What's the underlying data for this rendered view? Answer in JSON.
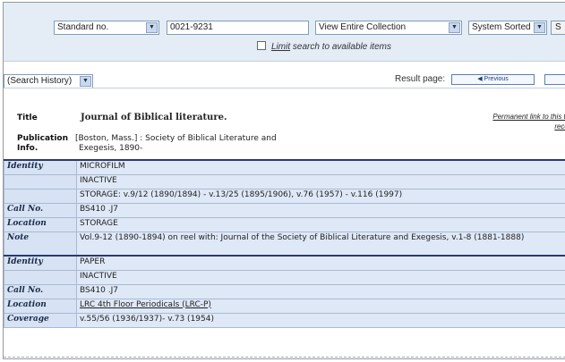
{
  "search": {
    "field_select": "Standard no.",
    "query_value": "0021-9231",
    "collection_select": "View Entire Collection",
    "sort_select": "System Sorted",
    "search_button": "S",
    "limit_prefix": "Limit",
    "limit_rest": " search to available items"
  },
  "history": {
    "select": "(Search History)"
  },
  "pagination": {
    "label": "Result page:",
    "previous": "Previous"
  },
  "bib": {
    "title_label": "Title",
    "title_value": "Journal of Biblical literature.",
    "pub_label_1": "Publication",
    "pub_label_2": "Info.",
    "pub_value_1": "[Boston, Mass.] : Society of Biblical Literature and",
    "pub_value_2": "Exegesis, 1890-",
    "permalink_1": "Permanent link to this title",
    "permalink_2": "record"
  },
  "holdings": [
    {
      "rows": [
        {
          "label": "Identity",
          "value": "MICROFILM"
        },
        {
          "label": "",
          "value": "INACTIVE"
        },
        {
          "label": "",
          "value": "STORAGE: v.9/12 (1890/1894) - v.13/25 (1895/1906), v.76 (1957) - v.116 (1997)"
        },
        {
          "label": "Call No.",
          "value": "BS410 .J7"
        },
        {
          "label": "Location",
          "value": "STORAGE"
        },
        {
          "label": "Note",
          "value": "Vol.9-12 (1890-1894) on reel with: Journal of the Society of Biblical Literature and Exegesis, v.1-8 (1881-1888)"
        }
      ]
    },
    {
      "rows": [
        {
          "label": "Identity",
          "value": "PAPER"
        },
        {
          "label": "",
          "value": "INACTIVE"
        },
        {
          "label": "Call No.",
          "value": "BS410 .J7"
        },
        {
          "label": "Location",
          "value": "LRC 4th Floor Periodicals (LRC-P)"
        },
        {
          "label": "Coverage",
          "value": "v.55/56 (1936/1937)- v.73 (1954)"
        }
      ]
    }
  ]
}
